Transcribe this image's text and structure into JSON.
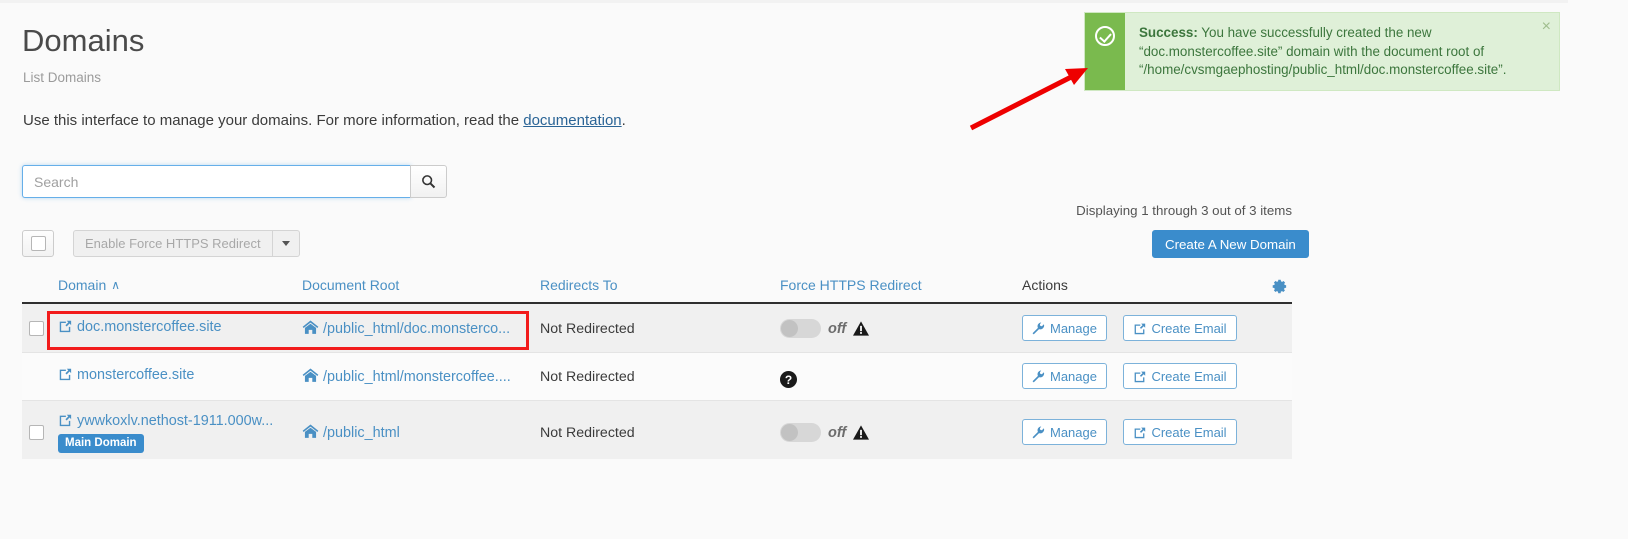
{
  "header": {
    "title": "Domains",
    "subtitle": "List Domains",
    "intro_before": "Use this interface to manage your domains. For more information, read the ",
    "intro_link": "documentation",
    "intro_after": "."
  },
  "alert": {
    "label": "Success:",
    "message": " You have successfully created the new “doc.monstercoffee.site” domain with the document root of “/home/cvsmgaephosting/public_html/doc.monstercoffee.site”.",
    "close_label": "×",
    "icon": "check-circle-icon",
    "bg_color": "#dff0d8",
    "accent_color": "#7aba4e",
    "text_color": "#3c763d"
  },
  "search": {
    "value": "",
    "placeholder": "Search",
    "button_icon": "search-icon"
  },
  "toolbar": {
    "select_all_checkbox": "",
    "bulk_action_label": "Enable Force HTTPS Redirect",
    "dropdown_icon": "chevron-down-icon",
    "displaying_text": "Displaying 1 through 3 out of 3 items",
    "create_button_label": "Create A New Domain",
    "create_button_color": "#3a8ccc"
  },
  "table": {
    "columns": [
      {
        "label": "Domain",
        "sortable": true,
        "sorted": "asc",
        "sort_icon": "∧"
      },
      {
        "label": "Document Root",
        "sortable": true
      },
      {
        "label": "Redirects To",
        "sortable": true
      },
      {
        "label": "Force HTTPS Redirect",
        "sortable": true
      },
      {
        "label": "Actions",
        "sortable": false
      }
    ],
    "settings_icon": "gear-icon",
    "rows": [
      {
        "domain": "doc.monstercoffee.site",
        "domain_icon": "external-link-icon",
        "document_root": "/public_html/doc.monsterco...",
        "docroot_icon": "home-icon",
        "redirects_to": "Not Redirected",
        "https_state": "off",
        "https_label": "off",
        "https_icon": "warning-triangle-icon",
        "badge": null,
        "has_checkbox": true,
        "actions": [
          {
            "label": "Manage",
            "icon": "wrench-icon"
          },
          {
            "label": "Create Email",
            "icon": "external-link-icon"
          }
        ]
      },
      {
        "domain": "monstercoffee.site",
        "domain_icon": "external-link-icon",
        "document_root": "/public_html/monstercoffee....",
        "docroot_icon": "home-icon",
        "redirects_to": "Not Redirected",
        "https_state": "unknown",
        "https_label": "",
        "https_icon": "question-circle-icon",
        "badge": null,
        "has_checkbox": false,
        "actions": [
          {
            "label": "Manage",
            "icon": "wrench-icon"
          },
          {
            "label": "Create Email",
            "icon": "external-link-icon"
          }
        ]
      },
      {
        "domain": "ywwkoxlv.nethost-1911.000w...",
        "domain_icon": "external-link-icon",
        "document_root": "/public_html",
        "docroot_icon": "home-icon",
        "redirects_to": "Not Redirected",
        "https_state": "off",
        "https_label": "off",
        "https_icon": "warning-triangle-icon",
        "badge": "Main Domain",
        "has_checkbox": true,
        "actions": [
          {
            "label": "Manage",
            "icon": "wrench-icon"
          },
          {
            "label": "Create Email",
            "icon": "external-link-icon"
          }
        ]
      }
    ]
  },
  "annotations": {
    "highlight_box_color": "#f21b1b",
    "arrow_color": "#ee0000"
  }
}
